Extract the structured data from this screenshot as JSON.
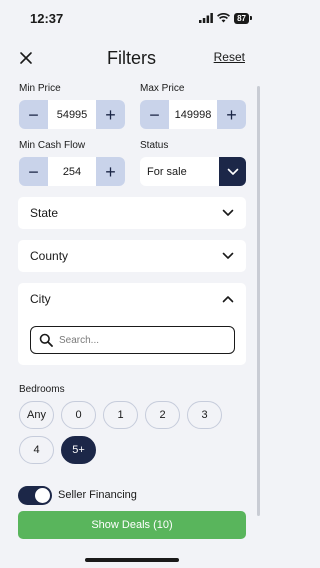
{
  "status_bar": {
    "time": "12:37",
    "battery": "87"
  },
  "header": {
    "title": "Filters",
    "reset_label": "Reset"
  },
  "min_price": {
    "label": "Min Price",
    "value": "54995",
    "minus": "−",
    "plus": "+"
  },
  "max_price": {
    "label": "Max Price",
    "value": "149998",
    "minus": "−",
    "plus": "+"
  },
  "min_cash_flow": {
    "label": "Min Cash Flow",
    "value": "254",
    "minus": "−",
    "plus": "+"
  },
  "status": {
    "label": "Status",
    "value": "For sale"
  },
  "state": {
    "label": "State"
  },
  "county": {
    "label": "County"
  },
  "city": {
    "label": "City",
    "search_placeholder": "Search..."
  },
  "bedrooms": {
    "label": "Bedrooms",
    "options": [
      "Any",
      "0",
      "1",
      "2",
      "3",
      "4",
      "5+"
    ],
    "selected": "5+"
  },
  "seller_financing": {
    "label": "Seller Financing",
    "enabled": true
  },
  "cta": {
    "label": "Show Deals (10)"
  },
  "colors": {
    "navy": "#1c2748",
    "stepper_blue": "#c9d3ea",
    "green": "#59b55c",
    "background": "#f2f3f7"
  },
  "icons": [
    "close-icon",
    "chevron-down-icon",
    "chevron-up-icon",
    "search-icon",
    "signal-icon",
    "wifi-icon",
    "battery-icon"
  ]
}
